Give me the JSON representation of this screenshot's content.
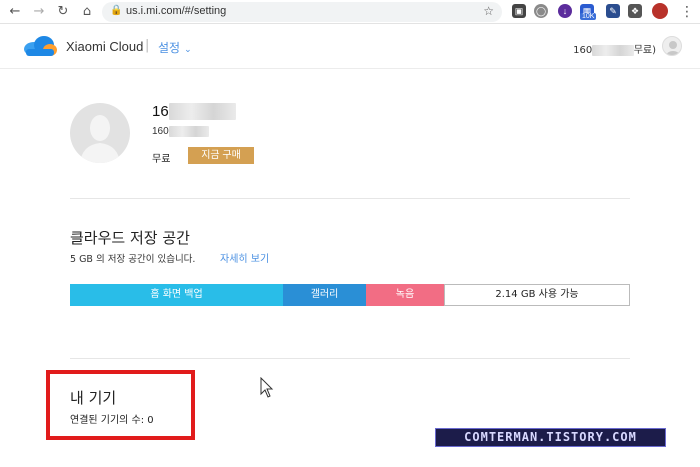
{
  "browser": {
    "url": "us.i.mi.com/#/setting",
    "badge": "10K"
  },
  "header": {
    "brand": "Xiaomi Cloud",
    "separator": "|",
    "settings_label": "설정",
    "account_id_prefix": "160",
    "account_hidden": "xxxxxxx",
    "account_plan": "무료)"
  },
  "profile": {
    "name_prefix": "16",
    "name_hidden": "xxxxxxxxx",
    "id_prefix": "160",
    "id_hidden": "xxxxxxxx",
    "plan": "무료",
    "buy_label": "지금 구매"
  },
  "storage": {
    "title": "클라우드 저장 공간",
    "description": "5 GB 의 저장 공간이 있습니다.",
    "details_link": "자세히 보기",
    "segments": [
      {
        "label": "홈 화면 백업",
        "fraction": 0.38,
        "color": "#29bde8"
      },
      {
        "label": "갤러리",
        "fraction": 0.148,
        "color": "#2a8fd6"
      },
      {
        "label": "녹음",
        "fraction": 0.14,
        "color": "#f26d84"
      },
      {
        "label": "2.14 GB 사용 가능",
        "fraction": 0.332,
        "color": "#ffffff"
      }
    ]
  },
  "devices": {
    "title": "내 기기",
    "count_label": "연결된 기기의 수: 0"
  },
  "watermark": {
    "text": "COMTERMAN.TISTORY.COM"
  },
  "colors": {
    "accent": "#4a90e2",
    "buy": "#d4a052",
    "highlight": "#e11b1b"
  }
}
